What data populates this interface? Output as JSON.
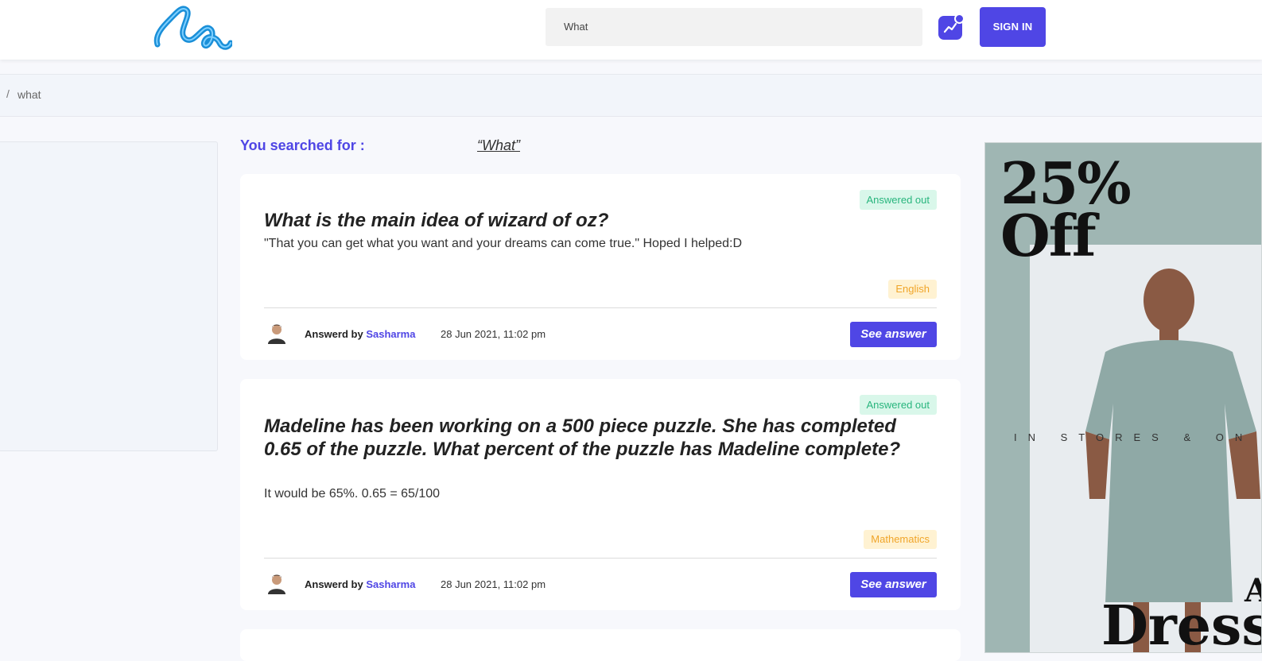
{
  "header": {
    "logo_name": "logo-icon",
    "search_value": "What",
    "sign_in_label": "SIGN IN"
  },
  "breadcrumb": {
    "separator": "/",
    "current": "what"
  },
  "search": {
    "label": "You searched for :",
    "term": "“What”"
  },
  "results": [
    {
      "status": "Answered out",
      "title": "What is the main idea of wizard of oz?",
      "answer": "\"That you can get what you want and your dreams can come true.\" Hoped I helped:D",
      "subject": "English",
      "answered_by_label": "Answerd by",
      "author": "Sasharma",
      "date": "28 Jun 2021, 11:02 pm",
      "button": "See answer"
    },
    {
      "status": "Answered out",
      "title": "Madeline has been working on a 500 piece puzzle. She has completed 0.65 of the puzzle. What percent of the puzzle has Madeline complete?",
      "answer": "It would be 65%. 0.65 = 65/100",
      "subject": "Mathematics",
      "answered_by_label": "Answerd by",
      "author": "Sasharma",
      "date": "28 Jun 2021, 11:02 pm",
      "button": "See answer"
    }
  ],
  "ad": {
    "headline": "25% Off",
    "tagline": "IN STORES & ON",
    "bottom_word": "Dress",
    "bottom_letter": "A"
  },
  "colors": {
    "accent": "#4f46e5",
    "answered_bg": "#d9f7ea",
    "answered_text": "#28b57d",
    "subject_bg": "#fff2d2",
    "subject_text": "#f0a52a"
  }
}
